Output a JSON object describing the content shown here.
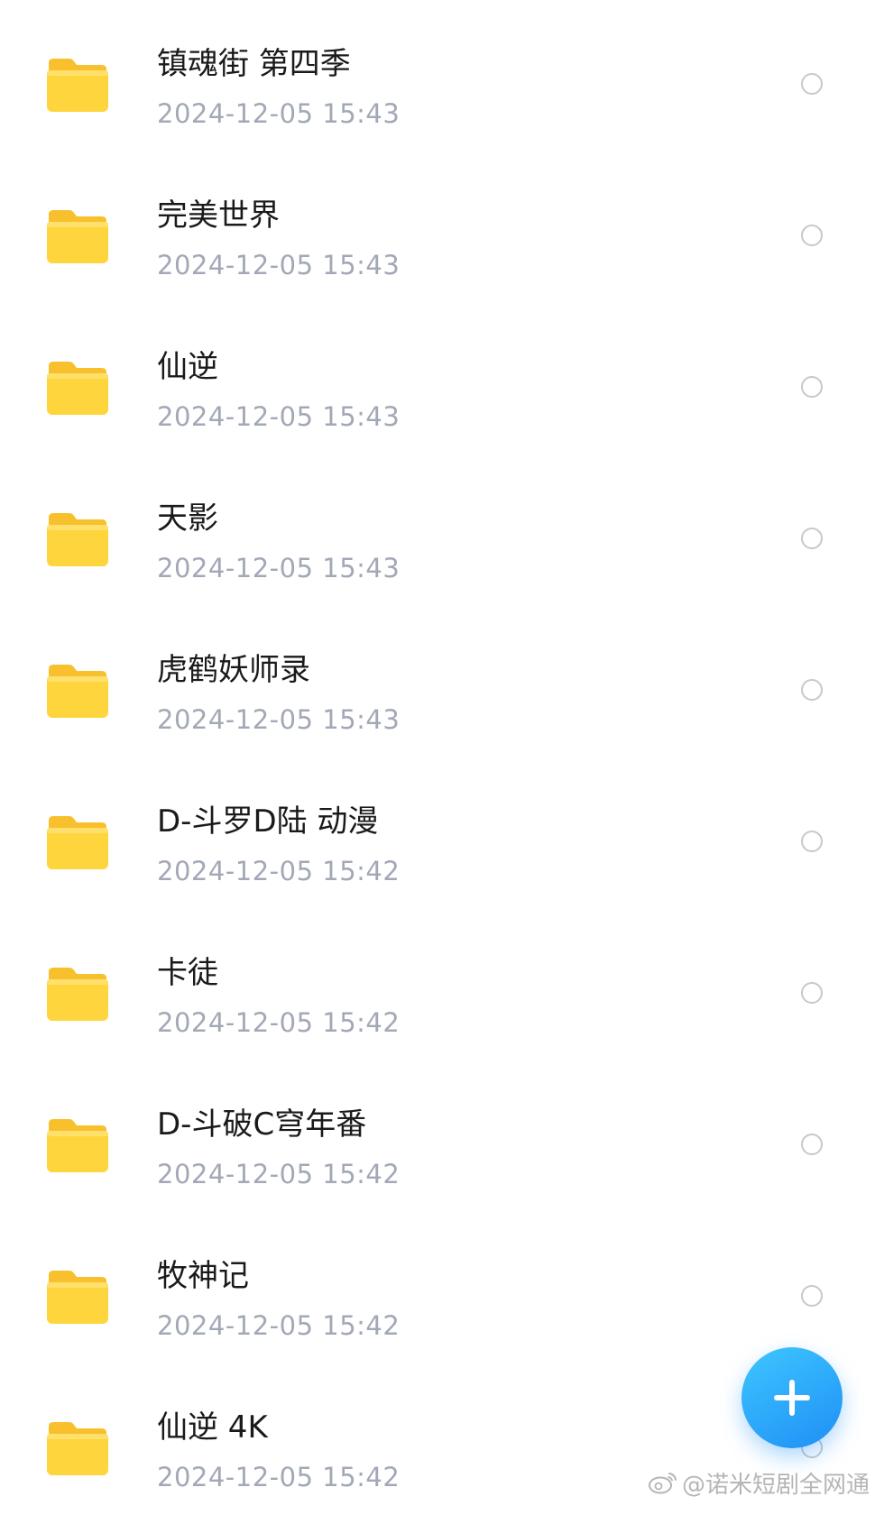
{
  "folders": [
    {
      "name": "镇魂街 第四季",
      "date": "2024-12-05  15:43"
    },
    {
      "name": "完美世界",
      "date": "2024-12-05  15:43"
    },
    {
      "name": "仙逆",
      "date": "2024-12-05  15:43"
    },
    {
      "name": "天影",
      "date": "2024-12-05  15:43"
    },
    {
      "name": "虎鹤妖师录",
      "date": "2024-12-05  15:43"
    },
    {
      "name": "D-斗罗D陆 动漫",
      "date": "2024-12-05  15:42"
    },
    {
      "name": "卡徒",
      "date": "2024-12-05  15:42"
    },
    {
      "name": "D-斗破C穹年番",
      "date": "2024-12-05  15:42"
    },
    {
      "name": "牧神记",
      "date": "2024-12-05  15:42"
    },
    {
      "name": "仙逆 4K",
      "date": "2024-12-05  15:42"
    }
  ],
  "icons": {
    "folder": "folder-icon",
    "select": "radio-circle-icon",
    "fab": "plus-icon",
    "watermark_logo": "weibo-icon"
  },
  "colors": {
    "folder": "#ffd53d",
    "folder_tab": "#f7c02c",
    "date_text": "#a2a8b6",
    "fab_start": "#3fc6ff",
    "fab_end": "#1e8ff5"
  },
  "watermark": {
    "text": "@诺米短剧全网通"
  }
}
